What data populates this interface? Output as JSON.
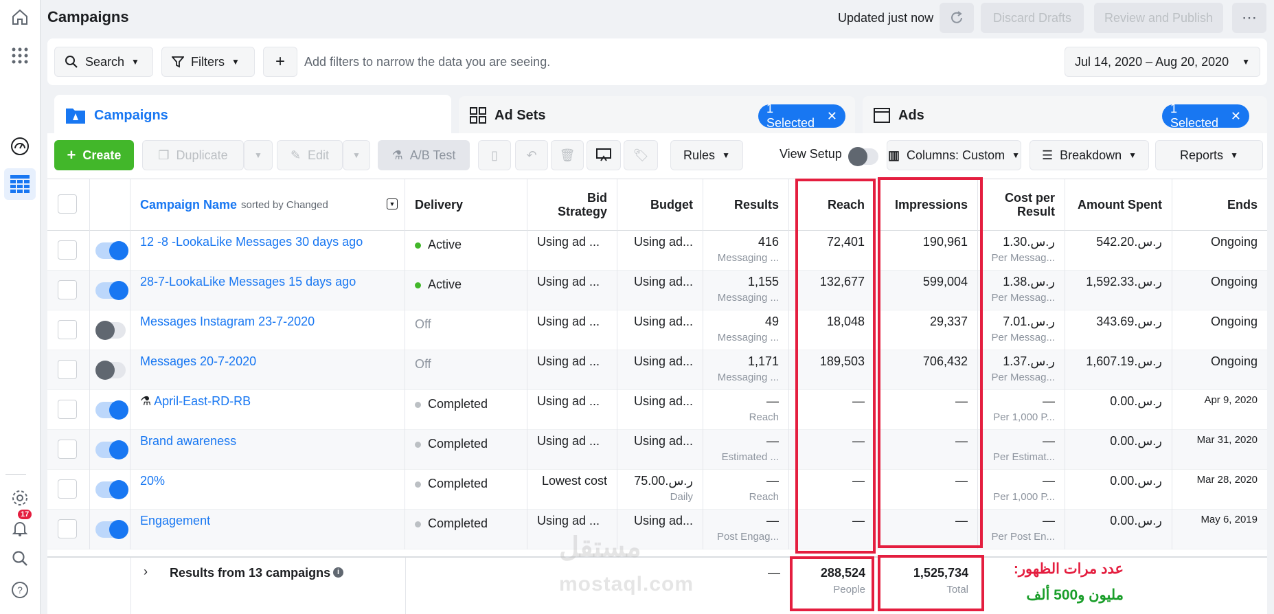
{
  "header": {
    "title": "Campaigns",
    "updated": "Updated just now",
    "discard": "Discard Drafts",
    "review": "Review and Publish"
  },
  "filters": {
    "search": "Search",
    "filters": "Filters",
    "hint": "Add filters to narrow the data you are seeing.",
    "date_range": "Jul 14, 2020 – Aug 20, 2020"
  },
  "tabs": {
    "campaigns": "Campaigns",
    "adsets": "Ad Sets",
    "ads": "Ads",
    "selected": "1 Selected"
  },
  "toolbar": {
    "create": "Create",
    "duplicate": "Duplicate",
    "edit": "Edit",
    "ab_test": "A/B Test",
    "rules": "Rules",
    "view_setup": "View Setup",
    "columns": "Columns: Custom",
    "breakdown": "Breakdown",
    "reports": "Reports"
  },
  "notifications": {
    "count": "17"
  },
  "table": {
    "headers": {
      "name": "Campaign Name",
      "sorted": "sorted by Changed",
      "delivery": "Delivery",
      "bid1": "Bid",
      "bid2": "Strategy",
      "budget": "Budget",
      "results": "Results",
      "reach": "Reach",
      "impressions": "Impressions",
      "cpr1": "Cost per",
      "cpr2": "Result",
      "spent": "Amount Spent",
      "ends": "Ends"
    },
    "rows": [
      {
        "name": "12 -8 -LookaLike Messages 30 days ago",
        "delivery": "Active",
        "bid": "Using ad ...",
        "budget": "Using ad...",
        "budget_sub": "",
        "results": "416",
        "results_sub": "Messaging ...",
        "reach": "72,401",
        "impressions": "190,961",
        "cpr": "ر.س.1.30",
        "cpr_sub": "Per Messag...",
        "spent": "ر.س.542.20",
        "ends": "Ongoing"
      },
      {
        "name": "28-7-LookaLike Messages 15 days ago",
        "delivery": "Active",
        "bid": "Using ad ...",
        "budget": "Using ad...",
        "budget_sub": "",
        "results": "1,155",
        "results_sub": "Messaging ...",
        "reach": "132,677",
        "impressions": "599,004",
        "cpr": "ر.س.1.38",
        "cpr_sub": "Per Messag...",
        "spent": "ر.س.1,592.33",
        "ends": "Ongoing"
      },
      {
        "name": "Messages Instagram 23-7-2020",
        "delivery": "Off",
        "bid": "Using ad ...",
        "budget": "Using ad...",
        "budget_sub": "",
        "results": "49",
        "results_sub": "Messaging ...",
        "reach": "18,048",
        "impressions": "29,337",
        "cpr": "ر.س.7.01",
        "cpr_sub": "Per Messag...",
        "spent": "ر.س.343.69",
        "ends": "Ongoing"
      },
      {
        "name": "Messages 20-7-2020",
        "delivery": "Off",
        "bid": "Using ad ...",
        "budget": "Using ad...",
        "budget_sub": "",
        "results": "1,171",
        "results_sub": "Messaging ...",
        "reach": "189,503",
        "impressions": "706,432",
        "cpr": "ر.س.1.37",
        "cpr_sub": "Per Messag...",
        "spent": "ر.س.1,607.19",
        "ends": "Ongoing"
      },
      {
        "name": "April-East-RD-RB",
        "delivery": "Completed",
        "bid": "Using ad ...",
        "budget": "Using ad...",
        "budget_sub": "",
        "results": "—",
        "results_sub": "Reach",
        "reach": "—",
        "impressions": "—",
        "cpr": "—",
        "cpr_sub": "Per 1,000 P...",
        "spent": "ر.س.0.00",
        "ends": "Apr 9, 2020"
      },
      {
        "name": "Brand awareness",
        "delivery": "Completed",
        "bid": "Using ad ...",
        "budget": "Using ad...",
        "budget_sub": "",
        "results": "—",
        "results_sub": "Estimated ...",
        "reach": "—",
        "impressions": "—",
        "cpr": "—",
        "cpr_sub": "Per Estimat...",
        "spent": "ر.س.0.00",
        "ends": "Mar 31, 2020"
      },
      {
        "name": "20%",
        "delivery": "Completed",
        "bid": "Lowest cost",
        "budget": "ر.س.75.00",
        "budget_sub": "Daily",
        "results": "—",
        "results_sub": "Reach",
        "reach": "—",
        "impressions": "—",
        "cpr": "—",
        "cpr_sub": "Per 1,000 P...",
        "spent": "ر.س.0.00",
        "ends": "Mar 28, 2020"
      },
      {
        "name": "Engagement",
        "delivery": "Completed",
        "bid": "Using ad ...",
        "budget": "Using ad...",
        "budget_sub": "",
        "results": "—",
        "results_sub": "Post Engag...",
        "reach": "—",
        "impressions": "—",
        "cpr": "—",
        "cpr_sub": "Per Post En...",
        "spent": "ر.س.0.00",
        "ends": "May 6, 2019"
      }
    ],
    "totals": {
      "label": "Results from 13 campaigns",
      "results": "—",
      "reach": "288,524",
      "reach_sub": "People",
      "impressions": "1,525,734",
      "impressions_sub": "Total"
    }
  },
  "annotation": {
    "line1": "عدد مرات الظهور:",
    "line2": "مليون و500 ألف"
  },
  "watermark": {
    "arabic": "مستقل",
    "latin": "mostaql.com"
  }
}
